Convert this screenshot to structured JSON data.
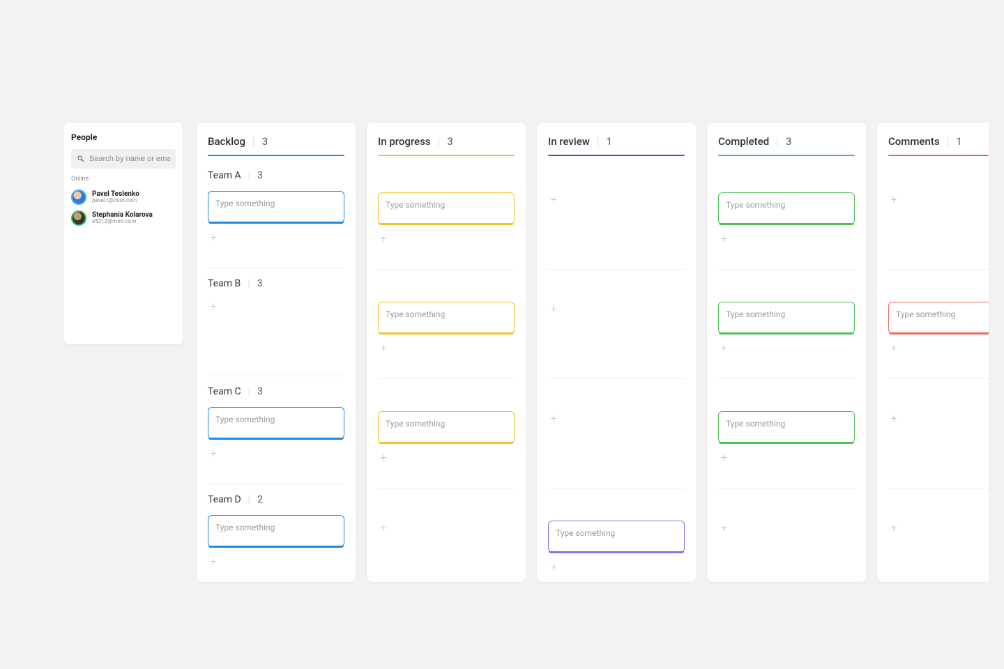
{
  "people": {
    "title": "People",
    "search_placeholder": "Search by name or email",
    "online_label": "Online",
    "list": [
      {
        "name": "Pavel Teslenko",
        "email": "pavel.t@miro.com"
      },
      {
        "name": "Stephania Kolarova",
        "email": "s5212@miro.com"
      }
    ]
  },
  "card_placeholder": "Type something",
  "columns": [
    {
      "title": "Backlog",
      "count": "3",
      "underline": "u-blue"
    },
    {
      "title": "In progress",
      "count": "3",
      "underline": "u-yellow"
    },
    {
      "title": "In review",
      "count": "1",
      "underline": "u-purple"
    },
    {
      "title": "Completed",
      "count": "3",
      "underline": "u-green"
    },
    {
      "title": "Comments",
      "count": "1",
      "underline": "u-red"
    }
  ],
  "groups": [
    {
      "title": "Team A",
      "count": "3"
    },
    {
      "title": "Team B",
      "count": "3"
    },
    {
      "title": "Team C",
      "count": "3"
    },
    {
      "title": "Team D",
      "count": "2"
    }
  ]
}
